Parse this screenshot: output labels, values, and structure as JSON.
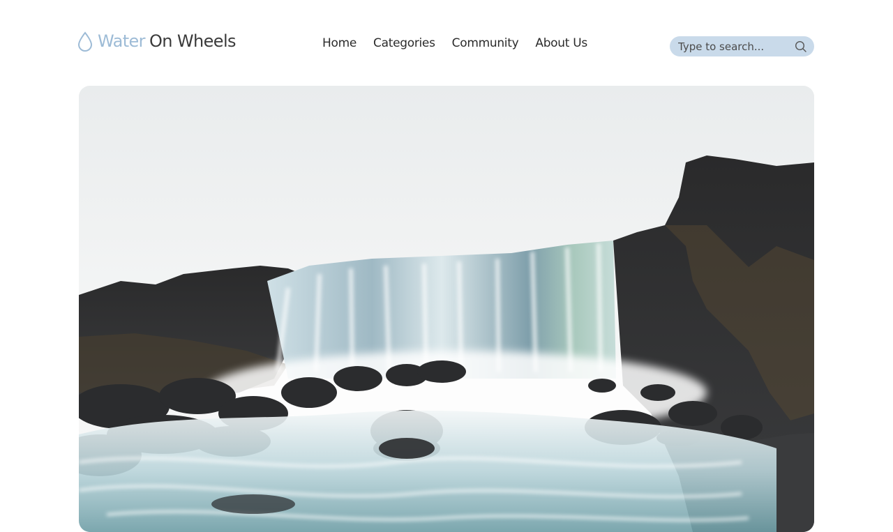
{
  "brand": {
    "word1": "Water",
    "word2": "On Wheels",
    "icon": "water-drop-icon",
    "accent_color": "#9dbbd6"
  },
  "nav": {
    "items": [
      {
        "label": "Home"
      },
      {
        "label": "Categories"
      },
      {
        "label": "Community"
      },
      {
        "label": "About Us"
      }
    ]
  },
  "search": {
    "placeholder": "Type to search...",
    "value": "",
    "icon": "search-icon",
    "background": "#c9daea"
  },
  "hero": {
    "subject": "waterfall-photo"
  }
}
